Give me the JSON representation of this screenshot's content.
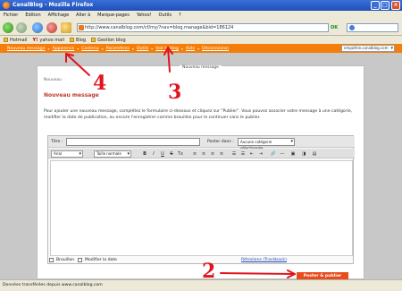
{
  "browser": {
    "window_title": "CanalBlog - Mozilla Firefox",
    "menu": [
      "Fichier",
      "Edition",
      "Affichage",
      "Aller à",
      "Marque-pages",
      "Yahoo!",
      "Outils",
      "?"
    ],
    "url": "http://www.canalblog.com/cf/my/?nav=blog.manage&bid=186124",
    "go_label": "OK",
    "bookmarks": [
      "Hotmail",
      "yahoo mail",
      "Blog",
      "Gestion blog"
    ],
    "status": "Données transférées depuis www.canalblog.com"
  },
  "sitebar": {
    "items": [
      "Nouveau message",
      "Apparence",
      "Contenu",
      "Paramètres",
      "Outils",
      "Voir le blog",
      "Aide",
      "Déconnexion"
    ],
    "blog_select": "empathie.canalblog.com"
  },
  "page": {
    "top_label": "Nouveau message",
    "breadcrumb": "Nouveau",
    "title": "Nouveau message",
    "intro": "Pour ajouter une nouveau message, complétez le formulaire ci-dessous et cliquez sur \"Publier\". Vous pouvez associer votre message à une catégorie, modifier la date de publication, ou encore l'enregistrer comme brouillon pour le continuer sans le publier."
  },
  "editor": {
    "title_label": "Titre :",
    "date_label": "Poster dans :",
    "category_value": "Aucune catégorie sélectionnée",
    "font_value": "Arial",
    "size_value": "Taille normale",
    "toolbar_icons": [
      "B",
      "I",
      "U",
      "S",
      "Tx",
      "≡",
      "≡",
      "≡",
      "≡",
      "☰",
      "☰",
      "⇤",
      "⇥",
      "🔗",
      "—",
      "▣",
      "◨",
      "▤"
    ]
  },
  "footer": {
    "draft_label": "Brouillon",
    "modify_date_label": "Modifier la date",
    "trackback_label": "Rétroliens (Trackback)",
    "publish_label": "Poster & publier"
  },
  "annotations": {
    "colors": {
      "accent": "#e0141e",
      "orange": "#f57e0a"
    },
    "numbers": [
      "4",
      "3",
      "2"
    ]
  }
}
